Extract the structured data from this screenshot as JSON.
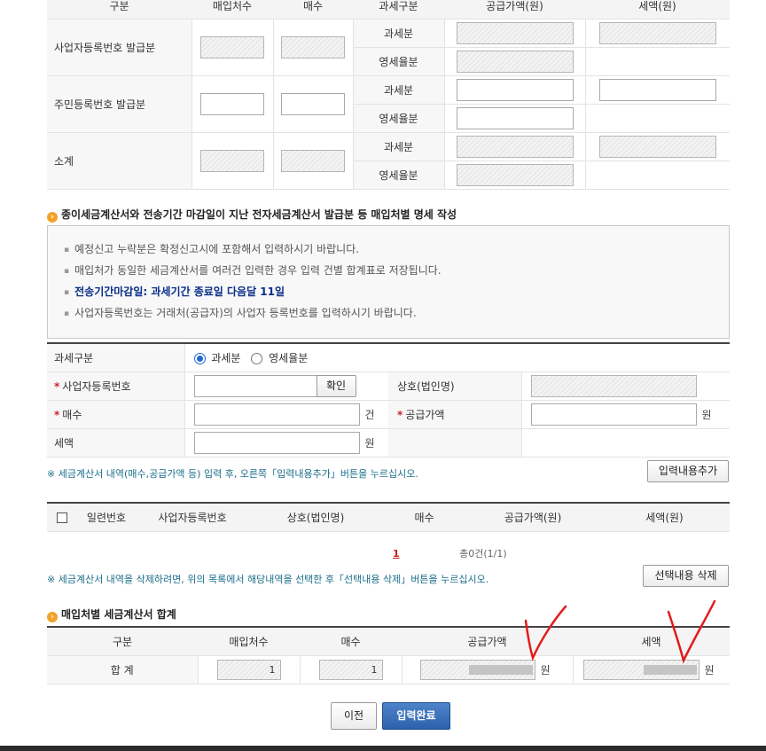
{
  "top_table": {
    "headers": [
      "구분",
      "매입처수",
      "매수",
      "과세구분",
      "공급가액(원)",
      "세액(원)"
    ],
    "rows": [
      {
        "label": "사업자등록번호 발급분",
        "sub": [
          "과세분",
          "영세율분"
        ]
      },
      {
        "label": "주민등록번호 발급분",
        "sub": [
          "과세분",
          "영세율분"
        ]
      },
      {
        "label": "소계",
        "sub": [
          "과세분",
          "영세율분"
        ]
      }
    ]
  },
  "section1": {
    "title": "종이세금계산서와 전송기간 마감일이 지난 전자세금계산서 발급분 등 매입처별 명세 작성"
  },
  "notice": {
    "items": [
      "예정신고 누락분은 확정신고시에 포함해서 입력하시기 바랍니다.",
      "매입처가 동일한 세금계산서를 여러건 입력한 경우 입력 건별 합계표로 저장됩니다.",
      "전송기간마감일: 과세기간 종료일 다음달 11일",
      "사업자등록번호는 거래처(공급자)의 사업자 등록번호를 입력하시기 바랍니다."
    ]
  },
  "form": {
    "tax_type_label": "과세구분",
    "tax_type_options": [
      "과세분",
      "영세율분"
    ],
    "tax_type_selected": "과세분",
    "bizno_label": "사업자등록번호",
    "confirm_btn": "확인",
    "company_label": "상호(법인명)",
    "count_label": "매수",
    "count_unit": "건",
    "supply_label": "공급가액",
    "supply_unit": "원",
    "tax_label": "세액",
    "tax_unit": "원"
  },
  "hint1": "※ 세금계산서 내역(매수,공급가액 등) 입력 후, 오른쪽「입력내용추가」버튼을 누르십시오.",
  "add_btn": "입력내용추가",
  "list_table": {
    "headers": [
      "일련번호",
      "사업자등록번호",
      "상호(법인명)",
      "매수",
      "공급가액(원)",
      "세액(원)"
    ]
  },
  "pager": {
    "page": "1",
    "summary": "총0건(1/1)"
  },
  "hint2": "※ 세금계산서 내역을 삭제하려면, 위의 목록에서 해당내역을 선택한 후「선택내용 삭제」버튼을 누르십시오.",
  "delete_btn": "선택내용 삭제",
  "section2": {
    "title": "매입처별 세금계산서 합계"
  },
  "sum_table": {
    "headers": [
      "구분",
      "매입처수",
      "매수",
      "공급가액",
      "세액"
    ],
    "row_label": "합 계",
    "vendors": "1",
    "count": "1",
    "supply_unit": "원",
    "tax_unit": "원"
  },
  "buttons": {
    "prev": "이전",
    "done": "입력완료"
  },
  "colors": {
    "accent_blue": "#2c62ad",
    "bullet_orange": "#f2a22a",
    "hint_teal": "#1a6e8a",
    "annotation_red": "#e21b1b"
  }
}
